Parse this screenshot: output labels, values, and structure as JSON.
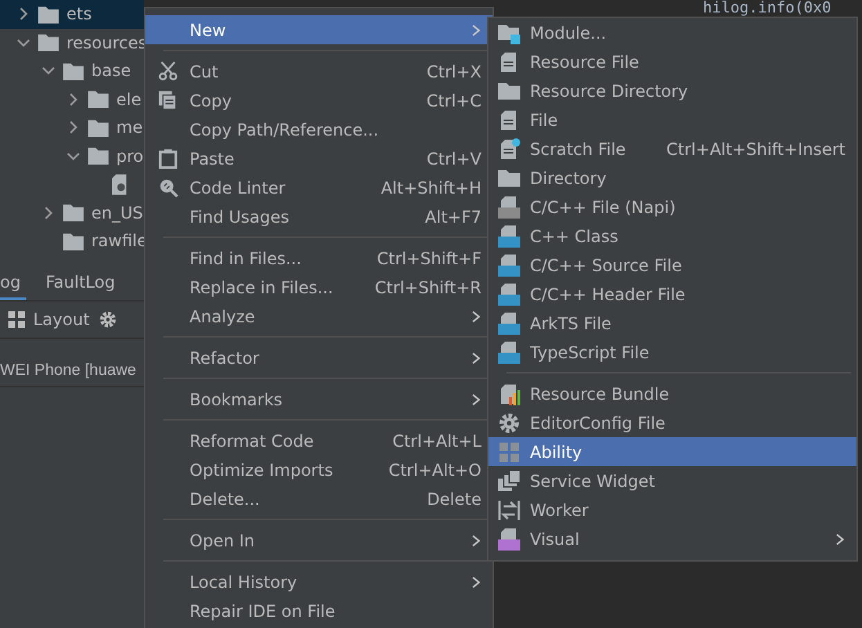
{
  "code_editor": {
    "visible_code": "hilog.info(0x0"
  },
  "project_tree": [
    {
      "label": "ets",
      "kind": "folder",
      "expanded": false,
      "selected": true
    },
    {
      "label": "resources",
      "kind": "folder",
      "expanded": true,
      "selected": false,
      "children": [
        {
          "label": "base",
          "kind": "folder",
          "expanded": true,
          "selected": false,
          "children": [
            {
              "label": "ele",
              "kind": "folder",
              "expanded": false,
              "selected": false
            },
            {
              "label": "me",
              "kind": "folder",
              "expanded": false,
              "selected": false
            },
            {
              "label": "pro",
              "kind": "folder",
              "expanded": true,
              "selected": false,
              "children": [
                {
                  "kind": "file",
                  "selected": false
                }
              ]
            }
          ]
        },
        {
          "label": "en_US",
          "kind": "folder",
          "expanded": false,
          "selected": false
        },
        {
          "label": "rawfile",
          "kind": "folder",
          "selected": false
        }
      ]
    }
  ],
  "tool_tabs": [
    {
      "label": "og",
      "selected": true
    },
    {
      "label": "FaultLog",
      "selected": false
    }
  ],
  "toolbar": {
    "layout_label": "Layout"
  },
  "device": "WEI Phone [huawe",
  "context_menu": {
    "groups": [
      [
        {
          "label": "New",
          "kind": "none",
          "has_submenu": true,
          "selected": true
        }
      ],
      [
        {
          "label": "Cut",
          "kind": "cut",
          "shortcut": "Ctrl+X",
          "has_submenu": false,
          "selected": false
        },
        {
          "label": "Copy",
          "kind": "copy",
          "shortcut": "Ctrl+C",
          "has_submenu": false,
          "selected": false
        },
        {
          "label": "Copy Path/Reference...",
          "kind": "none",
          "has_submenu": false,
          "selected": false
        },
        {
          "label": "Paste",
          "kind": "paste",
          "shortcut": "Ctrl+V",
          "has_submenu": false,
          "selected": false
        },
        {
          "label": "Code Linter",
          "kind": "linter",
          "shortcut": "Alt+Shift+H",
          "has_submenu": false,
          "selected": false
        },
        {
          "label": "Find Usages",
          "kind": "none",
          "shortcut": "Alt+F7",
          "has_submenu": false,
          "selected": false
        }
      ],
      [
        {
          "label": "Find in Files...",
          "kind": "none",
          "shortcut": "Ctrl+Shift+F",
          "has_submenu": false,
          "selected": false
        },
        {
          "label": "Replace in Files...",
          "kind": "none",
          "shortcut": "Ctrl+Shift+R",
          "has_submenu": false,
          "selected": false
        },
        {
          "label": "Analyze",
          "kind": "none",
          "has_submenu": true,
          "selected": false
        }
      ],
      [
        {
          "label": "Refactor",
          "kind": "none",
          "has_submenu": true,
          "selected": false
        }
      ],
      [
        {
          "label": "Bookmarks",
          "kind": "none",
          "has_submenu": true,
          "selected": false
        }
      ],
      [
        {
          "label": "Reformat Code",
          "kind": "none",
          "shortcut": "Ctrl+Alt+L",
          "has_submenu": false,
          "selected": false
        },
        {
          "label": "Optimize Imports",
          "kind": "none",
          "shortcut": "Ctrl+Alt+O",
          "has_submenu": false,
          "selected": false
        },
        {
          "label": "Delete...",
          "kind": "none",
          "shortcut": "Delete",
          "has_submenu": false,
          "selected": false
        }
      ],
      [
        {
          "label": "Open In",
          "kind": "none",
          "has_submenu": true,
          "selected": false
        }
      ],
      [
        {
          "label": "Local History",
          "kind": "none",
          "has_submenu": true,
          "selected": false
        },
        {
          "label": "Repair IDE on File",
          "kind": "none",
          "has_submenu": false,
          "selected": false
        }
      ]
    ]
  },
  "new_submenu": {
    "groups": [
      [
        {
          "label": "Module...",
          "kind": "module",
          "has_submenu": false,
          "selected": false
        },
        {
          "label": "Resource File",
          "kind": "resource-file",
          "has_submenu": false,
          "selected": false
        },
        {
          "label": "Resource Directory",
          "kind": "folder",
          "has_submenu": false,
          "selected": false
        },
        {
          "label": "File",
          "kind": "file",
          "has_submenu": false,
          "selected": false
        },
        {
          "label": "Scratch File",
          "kind": "scratch",
          "shortcut": "Ctrl+Alt+Shift+Insert",
          "has_submenu": false,
          "selected": false
        },
        {
          "label": "Directory",
          "kind": "folder",
          "has_submenu": false,
          "selected": false
        },
        {
          "label": "C/C++ File (Napi)",
          "kind": "c-file",
          "has_submenu": false,
          "selected": false
        },
        {
          "label": "C++ Class",
          "kind": "cpp-class",
          "has_submenu": false,
          "selected": false
        },
        {
          "label": "C/C++ Source File",
          "kind": "c-source",
          "has_submenu": false,
          "selected": false
        },
        {
          "label": "C/C++ Header File",
          "kind": "c-header",
          "has_submenu": false,
          "selected": false
        },
        {
          "label": "ArkTS File",
          "kind": "arkts",
          "has_submenu": false,
          "selected": false
        },
        {
          "label": "TypeScript File",
          "kind": "typescript",
          "has_submenu": false,
          "selected": false
        }
      ],
      [
        {
          "label": "Resource Bundle",
          "kind": "bundle",
          "has_submenu": false,
          "selected": false
        },
        {
          "label": "EditorConfig File",
          "kind": "config",
          "has_submenu": false,
          "selected": false
        },
        {
          "label": "Ability",
          "kind": "ability",
          "has_submenu": false,
          "selected": true
        },
        {
          "label": "Service Widget",
          "kind": "widget",
          "has_submenu": false,
          "selected": false
        },
        {
          "label": "Worker",
          "kind": "worker",
          "has_submenu": false,
          "selected": false
        },
        {
          "label": "Visual",
          "kind": "visual",
          "has_submenu": true,
          "selected": false
        }
      ]
    ]
  }
}
